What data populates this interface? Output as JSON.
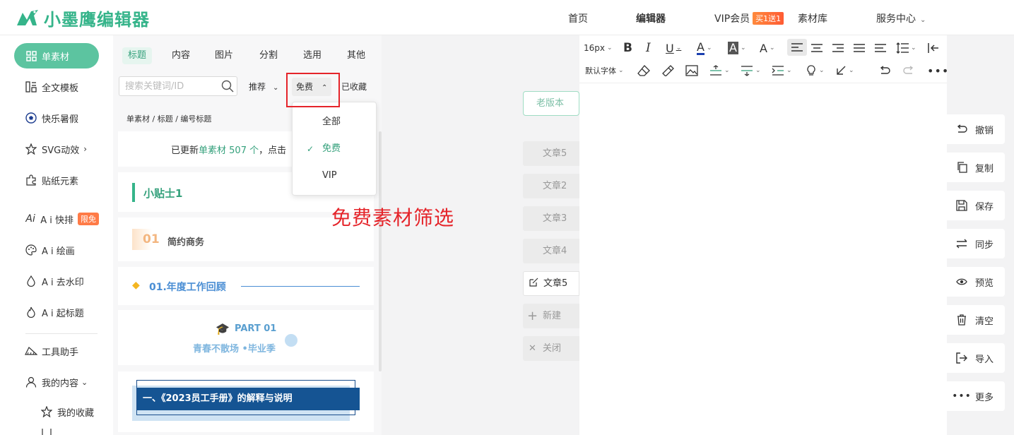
{
  "header": {
    "logo_text": "小墨鹰编辑器",
    "nav": [
      {
        "label": "首页"
      },
      {
        "label": "编辑器"
      },
      {
        "label": "VIP会员"
      },
      {
        "label": "素材库"
      },
      {
        "label": "服务中心"
      }
    ],
    "vip_badge": "买1送1",
    "brand_color": "#35b48a"
  },
  "sidebar": {
    "items": [
      {
        "label": "单素材",
        "icon": "grid-icon"
      },
      {
        "label": "全文模板",
        "icon": "layout-icon"
      },
      {
        "label": "快乐暑假",
        "icon": "soccer-ball-icon"
      },
      {
        "label": "SVG动效",
        "icon": "star-outline-icon"
      },
      {
        "label": "贴纸元素",
        "icon": "puzzle-icon"
      },
      {
        "label": "A i 快排",
        "icon": "ai-icon",
        "badge": "限免"
      },
      {
        "label": "A i 绘画",
        "icon": "palette-icon"
      },
      {
        "label": "A i 去水印",
        "icon": "drop-icon"
      },
      {
        "label": "A i 起标题",
        "icon": "flame-icon"
      },
      {
        "label": "工具助手",
        "icon": "ruler-icon"
      },
      {
        "label": "我的内容",
        "icon": "user-icon"
      },
      {
        "label": "我的收藏",
        "icon": "star-outline-icon"
      }
    ]
  },
  "panel": {
    "tabs": [
      "标题",
      "内容",
      "图片",
      "分割",
      "选用",
      "其他"
    ],
    "search_placeholder": "搜索关键词/ID",
    "filters": {
      "sort": "推荐",
      "price": "免费",
      "favorites": "已收藏"
    },
    "breadcrumb": [
      "单素材",
      "标题",
      "编号标题"
    ],
    "update_notice": {
      "prefix": "已更新",
      "highlight": "单素材 507 个",
      "suffix": "，点击"
    },
    "cards": [
      {
        "type": "tip",
        "text": "小贴士1"
      },
      {
        "type": "numbered",
        "number": "01",
        "text": "简约商务"
      },
      {
        "type": "line",
        "text": "01.年度工作回顾"
      },
      {
        "type": "part",
        "title": "PART 01",
        "subtitle": "青春不散场 •毕业季"
      },
      {
        "type": "banner",
        "text": "一、《2023员工手册》的解释与说明"
      }
    ]
  },
  "price_dropdown": {
    "options": [
      {
        "label": "全部",
        "selected": false
      },
      {
        "label": "免费",
        "selected": true
      },
      {
        "label": "VIP",
        "selected": false
      }
    ]
  },
  "annotation": "免费素材筛选",
  "articles": {
    "old_version_label": "老版本",
    "list": [
      "文章5",
      "文章2",
      "文章3",
      "文章4",
      "文章5"
    ],
    "current_index": 4,
    "new_label": "新建",
    "close_label": "关闭"
  },
  "editor": {
    "font_size": "16px",
    "font_family": "默认字体"
  },
  "actions": [
    {
      "label": "撤销",
      "icon": "undo-icon"
    },
    {
      "label": "复制",
      "icon": "copy-icon"
    },
    {
      "label": "保存",
      "icon": "save-icon"
    },
    {
      "label": "同步",
      "icon": "sync-icon"
    },
    {
      "label": "预览",
      "icon": "eye-icon"
    },
    {
      "label": "清空",
      "icon": "trash-icon"
    },
    {
      "label": "导入",
      "icon": "import-icon"
    },
    {
      "label": "更多",
      "icon": "more-icon"
    }
  ]
}
